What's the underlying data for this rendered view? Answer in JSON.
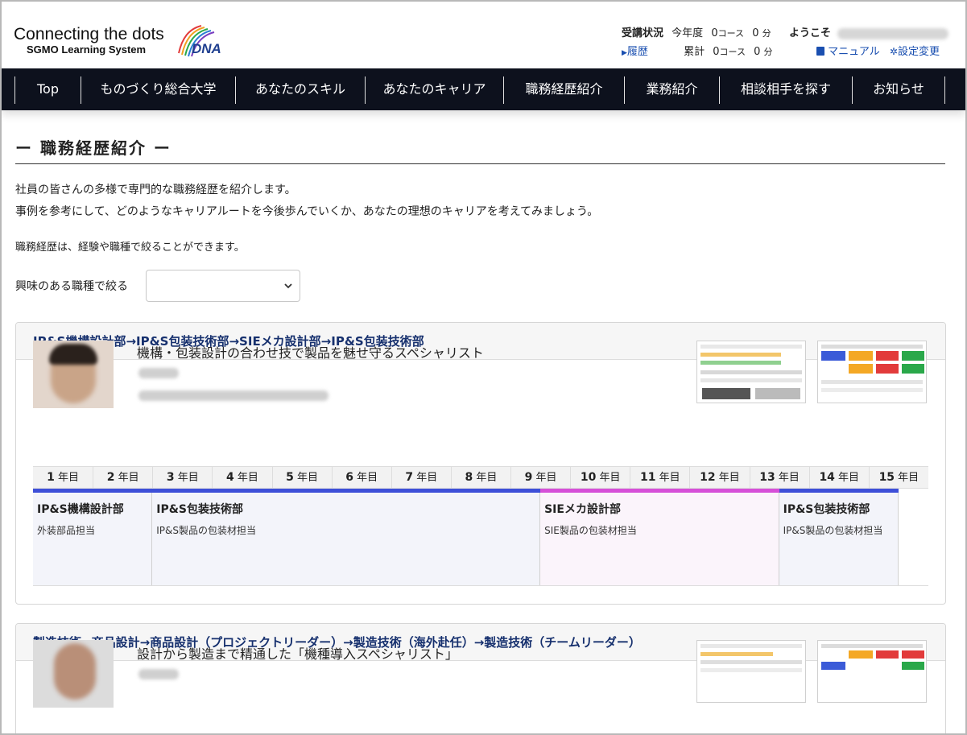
{
  "header": {
    "logo_main": "Connecting the dots",
    "logo_sub": "SGMO Learning System",
    "dna_logo_text": "DNA",
    "status_label": "受講状況",
    "this_year_label": "今年度",
    "this_year_courses": "0",
    "this_year_minutes": "0",
    "total_label": "累計",
    "total_courses": "0",
    "total_minutes": "0",
    "course_unit": "コース",
    "minute_unit": "分",
    "history_link": "履歴",
    "welcome_label": "ようこそ",
    "manual_link": "マニュアル",
    "settings_link": "設定変更"
  },
  "nav": {
    "items": [
      "Top",
      "ものづくり総合大学",
      "あなたのスキル",
      "あなたのキャリア",
      "職務経歴紹介",
      "業務紹介",
      "相談相手を探す",
      "お知らせ"
    ]
  },
  "page": {
    "title": "ー 職務経歴紹介 ー",
    "intro_line1": "社員の皆さんの多様で専門的な職務経歴を紹介します。",
    "intro_line2": "事例を参考にして、どのようなキャリアルートを今後歩んでいくか、あなたの理想のキャリアを考えてみましょう。",
    "intro_line3": "職務経歴は、経験や職種で絞ることができます。",
    "filter_label": "興味のある職種で絞る",
    "filter_value": ""
  },
  "cards": [
    {
      "route": "IP&S機構設計部→IP&S包装技術部→SIEメカ設計部→IP&S包装技術部",
      "headline": "機構・包装設計の合わせ技で製品を魅せ守るスペシャリスト",
      "timeline": {
        "year_unit": "年目",
        "years": [
          "1",
          "2",
          "3",
          "4",
          "5",
          "6",
          "7",
          "8",
          "9",
          "10",
          "11",
          "12",
          "13",
          "14",
          "15"
        ],
        "segments": [
          {
            "dept": "IP&S機構設計部",
            "desc": "外装部品担当",
            "start_year": 1,
            "end_year": 2,
            "color": "#3d4fd8",
            "bg": "#f3f4fa"
          },
          {
            "dept": "IP&S包装技術部",
            "desc": "IP&S製品の包装材担当",
            "start_year": 3,
            "end_year": 9,
            "color": "#3d4fd8",
            "bg": "#f3f4fa"
          },
          {
            "dept": "SIEメカ設計部",
            "desc": "SIE製品の包装材担当",
            "start_year": 9,
            "end_year": 13,
            "color": "#d64fd8",
            "bg": "#fbf4fb"
          },
          {
            "dept": "IP&S包装技術部",
            "desc": "IP&S製品の包装材担当",
            "start_year": 13,
            "end_year": 14,
            "color": "#3d4fd8",
            "bg": "#f3f4fa"
          }
        ]
      }
    },
    {
      "route": "製造技術→商品設計→商品設計（プロジェクトリーダー）→製造技術（海外赴任）→製造技術（チームリーダー）",
      "headline": "設計から製造まで精通した「機種導入スペシャリスト」"
    }
  ],
  "colors": {
    "nav_bg": "#0d111d",
    "link": "#1a4fb0",
    "card_title": "#16306e"
  }
}
